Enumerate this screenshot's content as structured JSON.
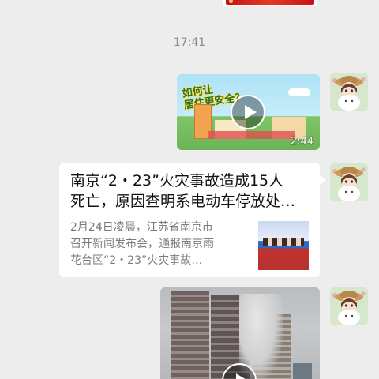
{
  "timestamp": "17:41",
  "video1": {
    "banner_line1": "如何让",
    "banner_line2": "居住更安全？",
    "duration": "2:44"
  },
  "link_card": {
    "title_line1": "南京“2・23”火灾事故造成15人",
    "title_line2": "死亡，原因查明系电动车停放处…",
    "desc_line1": "2月24日凌晨，江苏省南京市",
    "desc_line2": "召开新闻发布会，通报南京雨",
    "desc_line3": "花台区“2・23”火灾事故…"
  },
  "colors": {
    "background": "#ededed",
    "bubble": "#ffffff",
    "timestamp": "#8a8a8a"
  }
}
